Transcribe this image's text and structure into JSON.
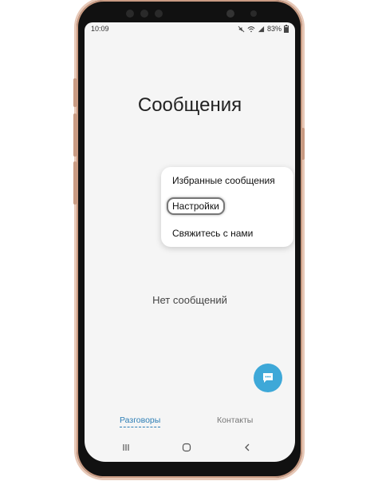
{
  "status_bar": {
    "time": "10:09",
    "battery": "83%",
    "icons": [
      "mute-icon",
      "wifi-icon",
      "signal-icon",
      "battery-icon"
    ]
  },
  "page": {
    "title": "Сообщения",
    "empty_text": "Нет сообщений"
  },
  "menu": {
    "items": [
      {
        "label": "Избранные сообщения"
      },
      {
        "label": "Настройки"
      },
      {
        "label": "Свяжитесь с нами"
      }
    ],
    "highlighted_item": "Настройки"
  },
  "tabs": {
    "active": "Разговоры",
    "inactive": "Контакты"
  },
  "fab": {
    "icon": "chat-bubble-icon",
    "color": "#3ea8d8"
  },
  "nav": {
    "icons": [
      "recent-apps-icon",
      "home-icon",
      "back-icon"
    ]
  },
  "colors": {
    "accent": "#2f7fb6",
    "phone_frame": "#c99b83"
  }
}
